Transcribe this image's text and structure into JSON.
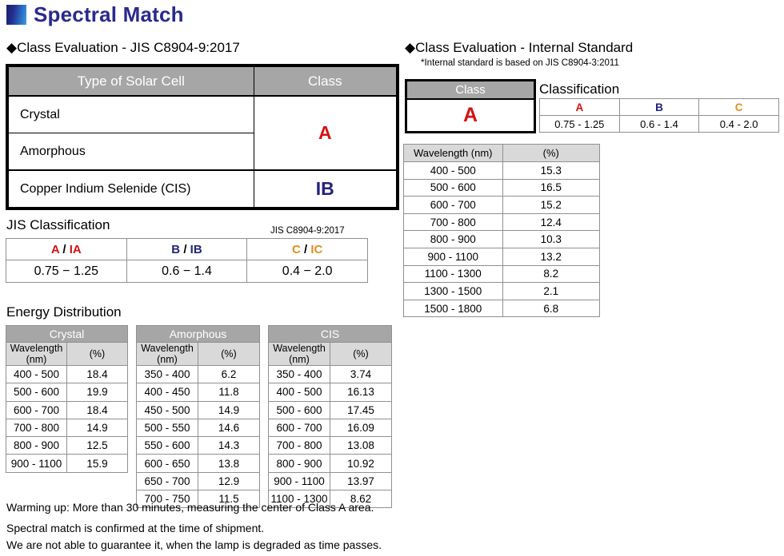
{
  "title": {
    "text": "Spectral Match",
    "logo_color_start": "#1b1f6b",
    "logo_color_end": "#3f9fe0",
    "text_color": "#2a2a8c"
  },
  "left": {
    "section_heading": "◆Class Evaluation - JIS C8904-9:2017",
    "solar_table": {
      "headers": [
        "Type of Solar Cell",
        "Class"
      ],
      "rows": [
        {
          "type": "Crystal",
          "class": "A"
        },
        {
          "type": "Amorphous",
          "class": "A"
        },
        {
          "type": "Copper Indium Selenide (CIS)",
          "class": "IB"
        }
      ],
      "class_merged_label": "A",
      "class_cis_label": "IB",
      "class_a_color": "#d41212",
      "class_ib_color": "#23237a"
    },
    "jis": {
      "label": "JIS Classification",
      "standard": "JIS C8904-9:2017",
      "columns": [
        {
          "code_main": "A",
          "code_alt": "IA",
          "color": "#d41212",
          "range": "0.75 − 1.25"
        },
        {
          "code_main": "B",
          "code_alt": "IB",
          "color": "#23237a",
          "range": "0.6 − 1.4"
        },
        {
          "code_main": "C",
          "code_alt": "IC",
          "color": "#e38c1e",
          "range": "0.4 − 2.0"
        }
      ],
      "separator": "/"
    },
    "energy": {
      "label": "Energy Distribution",
      "sub_headers": [
        "Wavelength (nm)",
        "(%)"
      ],
      "tables": [
        {
          "name": "Crystal",
          "rows": [
            [
              "400 - 500",
              "18.4"
            ],
            [
              "500 - 600",
              "19.9"
            ],
            [
              "600 - 700",
              "18.4"
            ],
            [
              "700 - 800",
              "14.9"
            ],
            [
              "800 - 900",
              "12.5"
            ],
            [
              "900 - 1100",
              "15.9"
            ]
          ]
        },
        {
          "name": "Amorphous",
          "rows": [
            [
              "350 - 400",
              "6.2"
            ],
            [
              "400 - 450",
              "11.8"
            ],
            [
              "450 - 500",
              "14.9"
            ],
            [
              "500 - 550",
              "14.6"
            ],
            [
              "550 - 600",
              "14.3"
            ],
            [
              "600 - 650",
              "13.8"
            ],
            [
              "650 - 700",
              "12.9"
            ],
            [
              "700 - 750",
              "11.5"
            ]
          ]
        },
        {
          "name": "CIS",
          "rows": [
            [
              "350 - 400",
              "3.74"
            ],
            [
              "400 - 500",
              "16.13"
            ],
            [
              "500 - 600",
              "17.45"
            ],
            [
              "600 - 700",
              "16.09"
            ],
            [
              "700 - 800",
              "13.08"
            ],
            [
              "800 - 900",
              "10.92"
            ],
            [
              "900 - 1100",
              "13.97"
            ],
            [
              "1100 - 1300",
              "8.62"
            ]
          ]
        }
      ]
    }
  },
  "right": {
    "section_heading": "◆Class Evaluation - Internal Standard",
    "note": "*Internal standard is based on JIS C8904-3:2011",
    "class_box": {
      "header": "Class",
      "value": "A",
      "value_color": "#d41212"
    },
    "classification": {
      "label": "Classification",
      "columns": [
        {
          "code": "A",
          "color": "#d41212",
          "range": "0.75 - 1.25"
        },
        {
          "code": "B",
          "color": "#23237a",
          "range": "0.6 - 1.4"
        },
        {
          "code": "C",
          "color": "#e38c1e",
          "range": "0.4 - 2.0"
        }
      ]
    },
    "spectral_table": {
      "headers": [
        "Wavelength (nm)",
        "(%)"
      ],
      "rows": [
        [
          "400 - 500",
          "15.3"
        ],
        [
          "500 - 600",
          "16.5"
        ],
        [
          "600 - 700",
          "15.2"
        ],
        [
          "700 - 800",
          "12.4"
        ],
        [
          "800 - 900",
          "10.3"
        ],
        [
          "900 - 1100",
          "13.2"
        ],
        [
          "1100 - 1300",
          "8.2"
        ],
        [
          "1300 - 1500",
          "2.1"
        ],
        [
          "1500 - 1800",
          "6.8"
        ]
      ]
    }
  },
  "footer": {
    "line1": "Warming up: More than 30 minutes, measuring the center of Class A area.",
    "line2": "Spectral match is confirmed at the time of shipment.",
    "line3": "We are not able to guarantee it, when the lamp is degraded as time passes."
  }
}
